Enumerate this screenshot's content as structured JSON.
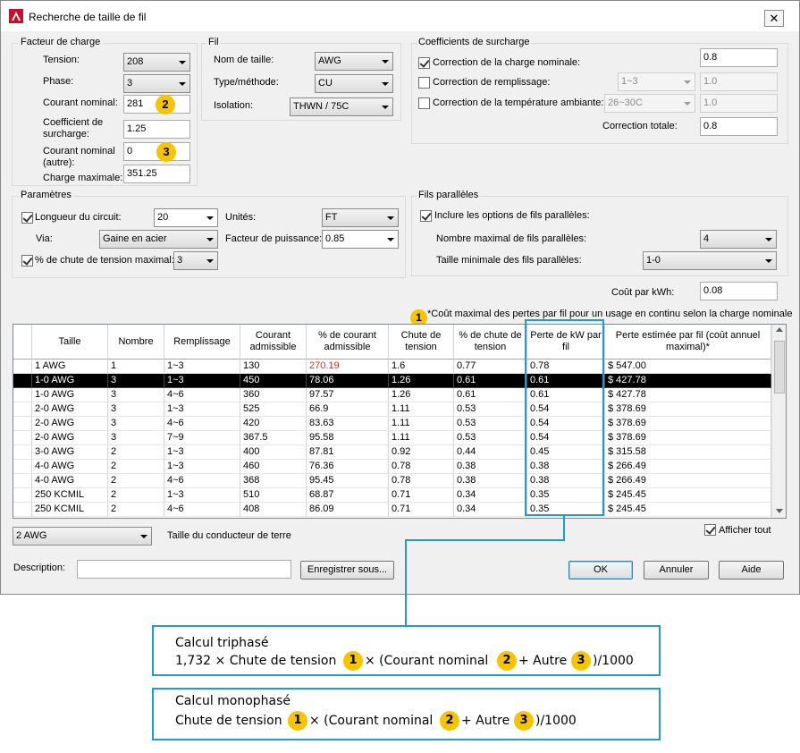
{
  "window": {
    "title": "Recherche de taille de fil",
    "close_glyph": "✕"
  },
  "load_factor": {
    "title": "Facteur de charge",
    "voltage_label": "Tension:",
    "voltage_value": "208",
    "phase_label": "Phase:",
    "phase_value": "3",
    "rated_current_label": "Courant nominal:",
    "rated_current_value": "281",
    "overload_label_1": "Coefficient de",
    "overload_label_2": "surcharge:",
    "overload_value": "1.25",
    "other_current_label_1": "Courant nominal",
    "other_current_label_2": "(autre):",
    "other_current_value": "0",
    "max_load_label": "Charge maximale:",
    "max_load_value": "351.25"
  },
  "wire": {
    "title": "Fil",
    "size_name_label": "Nom de taille:",
    "size_name_value": "AWG",
    "type_label": "Type/méthode:",
    "type_value": "CU",
    "insulation_label": "Isolation:",
    "insulation_value": "THWN / 75C"
  },
  "correction": {
    "title": "Coefficients de surcharge",
    "nominal_label": "Correction de la charge nominale:",
    "nominal_value": "0.8",
    "fill_label": "Correction de remplissage:",
    "fill_select": "1~3",
    "fill_value": "1.0",
    "temp_label": "Correction de la température ambiante:",
    "temp_select": "26~30C",
    "temp_value": "1.0",
    "total_label": "Correction totale:",
    "total_value": "0.8"
  },
  "params": {
    "title": "Paramètres",
    "length_label": "Longueur du circuit:",
    "length_value": "20",
    "units_label": "Unités:",
    "units_value": "FT",
    "via_label": "Via:",
    "via_value": "Gaine en acier",
    "pf_label": "Facteur de puissance:",
    "pf_value": "0.85",
    "vdrop_label": "% de chute de tension maximal:",
    "vdrop_value": "3"
  },
  "parallel": {
    "title": "Fils parallèles",
    "include_label": "Inclure les options de fils parallèles:",
    "max_label": "Nombre maximal de fils parallèles:",
    "max_value": "4",
    "min_size_label": "Taille minimale des fils parallèles:",
    "min_size_value": "1-0"
  },
  "cost": {
    "label": "Coût par kWh:",
    "value": "0.08",
    "note": "*Coût maximal des pertes par fil pour un usage en continu selon la charge nominale"
  },
  "table": {
    "headers": [
      "Taille",
      "Nombre",
      "Remplissage",
      "Courant admissible",
      "% de courant admissible",
      "Chute de tension",
      "% de chute de tension",
      "Perte de kW par fil",
      "Perte estimée par fil (coût annuel maximal)*"
    ],
    "rows": [
      [
        "1 AWG",
        "1",
        "1~3",
        "130",
        "270.19",
        "1.6",
        "0.77",
        "0.78",
        "$ 547.00"
      ],
      [
        "1-0 AWG",
        "3",
        "1~3",
        "450",
        "78.06",
        "1.26",
        "0.61",
        "0.61",
        "$ 427.78"
      ],
      [
        "1-0 AWG",
        "3",
        "4~6",
        "360",
        "97.57",
        "1.26",
        "0.61",
        "0.61",
        "$ 427.78"
      ],
      [
        "2-0 AWG",
        "3",
        "1~3",
        "525",
        "66.9",
        "1.11",
        "0.53",
        "0.54",
        "$ 378.69"
      ],
      [
        "2-0 AWG",
        "3",
        "4~6",
        "420",
        "83.63",
        "1.11",
        "0.53",
        "0.54",
        "$ 378.69"
      ],
      [
        "2-0 AWG",
        "3",
        "7~9",
        "367.5",
        "95.58",
        "1.11",
        "0.53",
        "0.54",
        "$ 378.69"
      ],
      [
        "3-0 AWG",
        "2",
        "1~3",
        "400",
        "87.81",
        "0.92",
        "0.44",
        "0.45",
        "$ 315.58"
      ],
      [
        "4-0 AWG",
        "2",
        "1~3",
        "460",
        "76.36",
        "0.78",
        "0.38",
        "0.38",
        "$ 266.49"
      ],
      [
        "4-0 AWG",
        "2",
        "4~6",
        "368",
        "95.45",
        "0.78",
        "0.38",
        "0.38",
        "$ 266.49"
      ],
      [
        "250 KCMIL",
        "2",
        "1~3",
        "510",
        "68.87",
        "0.71",
        "0.34",
        "0.35",
        "$ 245.45"
      ],
      [
        "250 KCMIL",
        "2",
        "4~6",
        "408",
        "86.09",
        "0.71",
        "0.34",
        "0.35",
        "$ 245.45"
      ]
    ],
    "selected_row": 1,
    "red_cell": [
      0,
      4
    ]
  },
  "ground": {
    "value": "2 AWG",
    "label": "Taille du conducteur de terre"
  },
  "show_all": {
    "label": "Afficher tout"
  },
  "description": {
    "label": "Description:",
    "value": ""
  },
  "buttons": {
    "save_as": "Enregistrer sous...",
    "ok": "OK",
    "cancel": "Annuler",
    "help": "Aide"
  },
  "badges": {
    "b1": "1",
    "b2": "2",
    "b3": "3"
  },
  "callout_three_phase": {
    "title": "Calcul triphasé",
    "f1": "1,732 × Chute de tension",
    "f2": "× (Courant nominal",
    "f3": "+ Autre",
    "f4": ")/1000"
  },
  "callout_single_phase": {
    "title": "Calcul monophasé",
    "f1": "Chute de tension",
    "f2": "× (Courant nominal",
    "f3": "+ Autre",
    "f4": ")/1000"
  },
  "colors": {
    "accent": "#1e9bd7",
    "badge": "#f7c400",
    "red": "#e0282a"
  }
}
